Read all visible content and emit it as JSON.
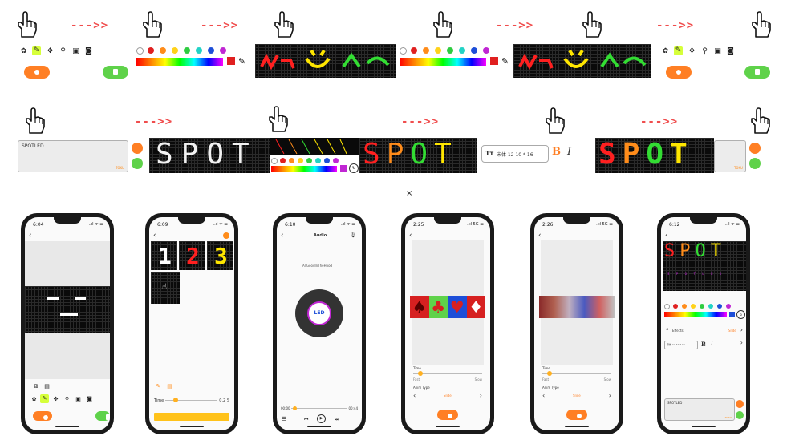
{
  "flow_arrow": "--->>",
  "spotled_text": "SPOTLED",
  "spot_text": "SPOT",
  "spot_chars": [
    "S",
    "P",
    "O",
    "T"
  ],
  "spot_colors": [
    "#ff2020",
    "#ff8c1a",
    "#33dd33",
    "#ffe600"
  ],
  "text_counter": "TOKU",
  "font_bar": {
    "icon": "Tт",
    "label": "宋体 12 10 * 16",
    "bold": "B",
    "italic": "I"
  },
  "palette_colors": [
    "#ffffff",
    "#e02020",
    "#ff8c1a",
    "#ffd21a",
    "#2ecc40",
    "#22d3c6",
    "#1d4ed8",
    "#c026d3"
  ],
  "accent_red": "#e02020",
  "orange_button_color": "#ff7f24",
  "green_button_color": "#5fd24a",
  "close_mark": "×",
  "phones": [
    {
      "time": "6:04",
      "status": "..ıl ᯤ ▬"
    },
    {
      "time": "6:09",
      "status": "..ıl ᯤ ▬",
      "tiles": [
        "1",
        "2",
        "3"
      ],
      "time_label": "Time",
      "time_value": "0.2 S"
    },
    {
      "time": "6:10",
      "status": "..ıl ᯤ ▬",
      "title": "Audio",
      "track": "AllGoodInTheHood",
      "disc_label": "LED",
      "elapsed": "00:00",
      "total": "00:44"
    },
    {
      "time": "2:25",
      "status": "..ıl 5G ▬",
      "time_label": "Time",
      "fast": "Fast",
      "slow": "Slow",
      "anim_label": "Anim Type",
      "anim_value": "Slide"
    },
    {
      "time": "2:26",
      "status": "..ıl 5G ▬",
      "time_label": "Time",
      "fast": "Fast",
      "slow": "Slow",
      "anim_label": "Anim Type",
      "anim_value": "Slide"
    },
    {
      "time": "6:12",
      "status": "..ıl ᯤ ▬",
      "effects": "Effects",
      "effect_value": "Slide",
      "font_label": "宋体 12 10 * 16",
      "bold": "B",
      "italic": "I",
      "text_value": "SPOTLED",
      "counter": "TOKU",
      "preview_sub": "S P O T L E D"
    }
  ]
}
